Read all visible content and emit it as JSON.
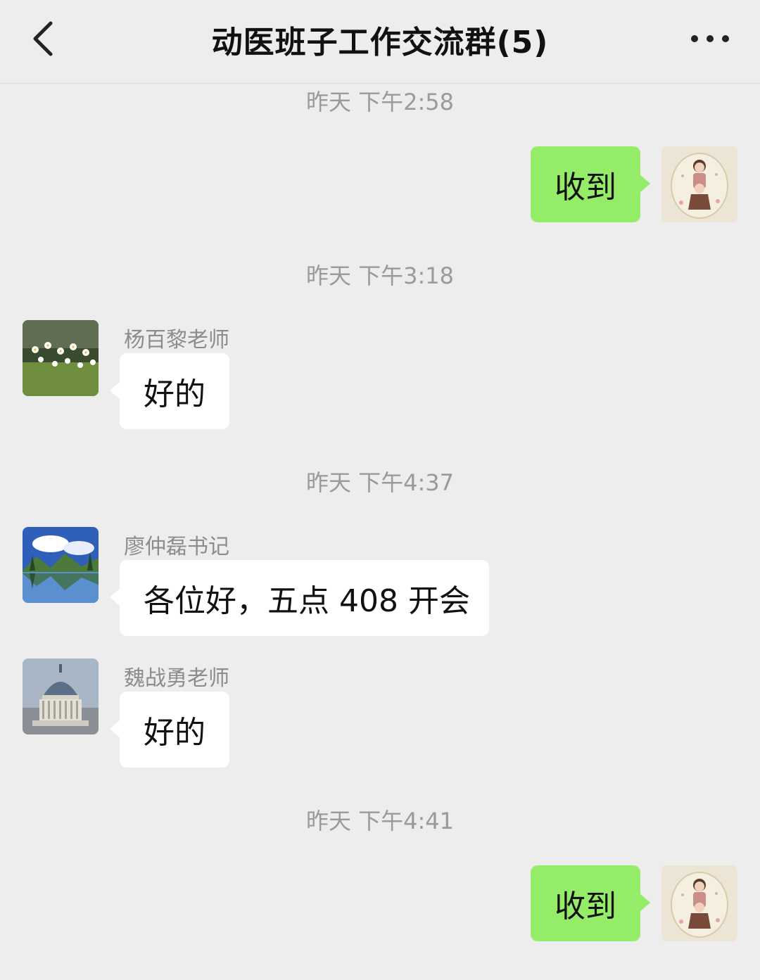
{
  "header": {
    "title": "动医班子工作交流群(5)",
    "back_icon": "chevron-left-icon",
    "more_icon": "more-dots-icon"
  },
  "timestamps": [
    "昨天 下午2:58",
    "昨天 下午3:18",
    "昨天 下午4:37",
    "昨天 下午4:41"
  ],
  "messages": [
    {
      "direction": "out",
      "sender": "",
      "text": "收到",
      "avatar": "illustrated-girls-avatar"
    },
    {
      "direction": "in",
      "sender": "杨百黎老师",
      "text": "好的",
      "avatar": "daisy-field-avatar"
    },
    {
      "direction": "in",
      "sender": "廖仲磊书记",
      "text": "各位好，五点 408 开会",
      "avatar": "lake-landscape-avatar"
    },
    {
      "direction": "in",
      "sender": "魏战勇老师",
      "text": "好的",
      "avatar": "domed-building-avatar"
    },
    {
      "direction": "out",
      "sender": "",
      "text": "收到",
      "avatar": "illustrated-girls-avatar"
    }
  ],
  "colors": {
    "background": "#ededed",
    "outgoing_bubble": "#95ec69",
    "incoming_bubble": "#ffffff",
    "timestamp_text": "#9a9a9a",
    "sender_text": "#8c8c8c"
  }
}
